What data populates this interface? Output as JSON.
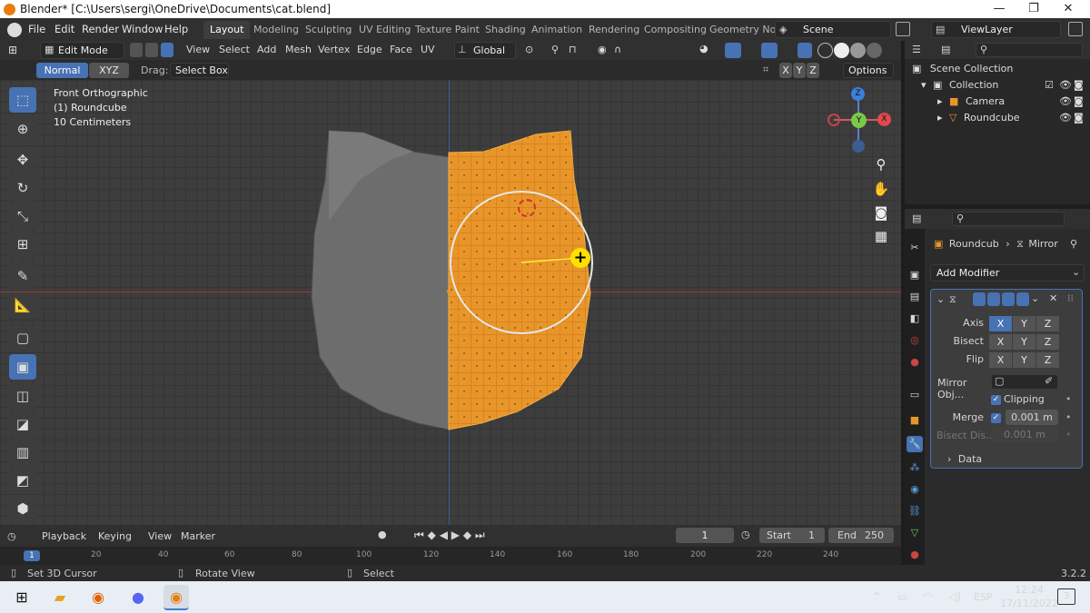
{
  "window": {
    "title": "Blender* [C:\\Users\\sergi\\OneDrive\\Documents\\cat.blend]",
    "minimize": "—",
    "maximize": "❐",
    "close": "✕"
  },
  "topbar": {
    "menus": [
      "File",
      "Edit",
      "Render",
      "Window",
      "Help"
    ],
    "workspaces": [
      "Layout",
      "Modeling",
      "Sculpting",
      "UV Editing",
      "Texture Paint",
      "Shading",
      "Animation",
      "Rendering",
      "Compositing",
      "Geometry Noc"
    ],
    "scene": "Scene",
    "view_layer": "ViewLayer"
  },
  "viewport_header": {
    "mode": "Edit Mode",
    "menus": [
      "View",
      "Select",
      "Add",
      "Mesh",
      "Vertex",
      "Edge",
      "Face",
      "UV"
    ],
    "orientation": "Global"
  },
  "tool_settings": {
    "normal": "Normal",
    "xyz": "XYZ",
    "drag_label": "Drag:",
    "drag_value": "Select Box",
    "x": "X",
    "y": "Y",
    "z": "Z",
    "options": "Options"
  },
  "viewport": {
    "view_name": "Front Orthographic",
    "object": "(1) Roundcube",
    "scale": "10 Centimeters",
    "gizmo": {
      "x": "X",
      "y": "Y",
      "z": "Z"
    }
  },
  "outliner": {
    "items": [
      {
        "label": "Scene Collection",
        "depth": 0
      },
      {
        "label": "Collection",
        "depth": 1
      },
      {
        "label": "Camera",
        "depth": 2
      },
      {
        "label": "Roundcube",
        "depth": 2
      }
    ]
  },
  "properties": {
    "breadcrumb_object": "Roundcub",
    "breadcrumb_modifier": "Mirror",
    "add_modifier": "Add Modifier",
    "axis_label": "Axis",
    "bisect_label": "Bisect",
    "flip_label": "Flip",
    "x": "X",
    "y": "Y",
    "z": "Z",
    "mirror_object_label": "Mirror Obj...",
    "clipping_label": "Clipping",
    "merge_label": "Merge",
    "merge_value": "0.001 m",
    "bisect_distance_label": "Bisect Dis...",
    "bisect_distance_value": "0.001 m",
    "data_label": "Data"
  },
  "timeline": {
    "menus": [
      "Playback",
      "Keying",
      "View",
      "Marker"
    ],
    "current_frame": "1",
    "start_label": "Start",
    "start_value": "1",
    "end_label": "End",
    "end_value": "250",
    "ruler": [
      "1",
      "20",
      "40",
      "60",
      "80",
      "100",
      "120",
      "140",
      "160",
      "180",
      "200",
      "220",
      "240"
    ]
  },
  "statusbar": {
    "hint1": "Set 3D Cursor",
    "hint2": "Rotate View",
    "hint3": "Select",
    "version": "3.2.2"
  },
  "taskbar": {
    "lang": "ESP",
    "time": "12:24",
    "date": "17/11/2022",
    "notifications": "3"
  },
  "colors": {
    "accent": "#4772b3",
    "selection": "#e8952a",
    "active_tab": "#4772b3"
  }
}
